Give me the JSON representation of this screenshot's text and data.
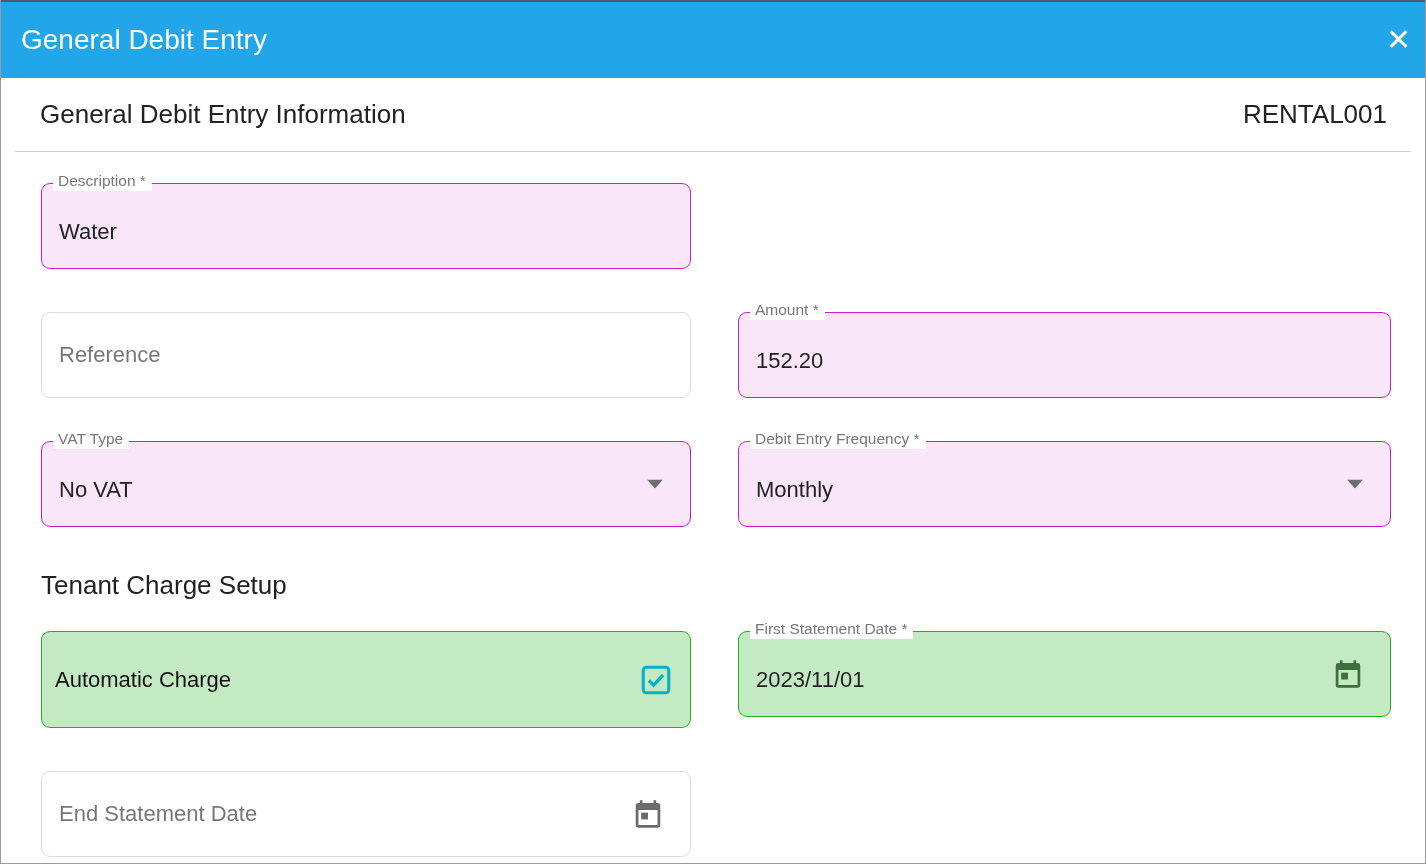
{
  "dialog": {
    "title": "General Debit Entry",
    "close": "✕"
  },
  "info": {
    "title": "General Debit Entry Information",
    "code": "RENTAL001"
  },
  "rows": [
    {
      "left": {
        "kind": "text",
        "label": "Description *",
        "value": "Water",
        "color": "#cc1fcc"
      }
    },
    {
      "left": {
        "kind": "text",
        "placeholder": "Reference"
      },
      "right": {
        "kind": "text",
        "label": "Amount *",
        "value": "152.20",
        "color": "#cc1fcc"
      }
    },
    {
      "left": {
        "kind": "select",
        "label": "VAT Type",
        "value": "No VAT",
        "color": "#cc1fcc"
      },
      "right": {
        "kind": "select",
        "label": "Debit Entry Frequency *",
        "value": "Monthly",
        "color": "#cc1fcc"
      }
    },
    {
      "heading": "Tenant Charge Setup"
    },
    {
      "left": {
        "kind": "checkbox",
        "text": "Automatic Charge",
        "checked": true,
        "color": "#22b022"
      },
      "right": {
        "kind": "date",
        "label": "First Statement Date *",
        "value": "2023/11/01",
        "color": "#22b022"
      }
    },
    {
      "left": {
        "kind": "date",
        "placeholder": "End Statement Date"
      }
    }
  ]
}
